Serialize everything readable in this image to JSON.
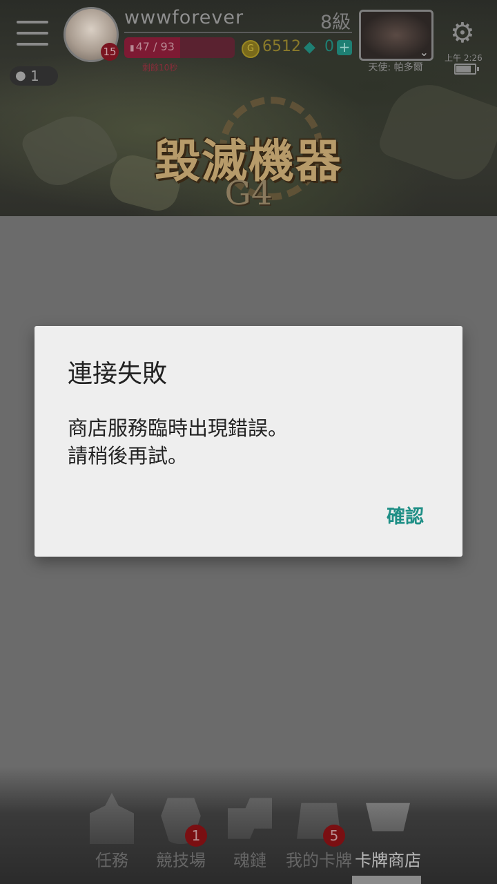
{
  "header": {
    "username": "wwwforever",
    "player_level": "8級",
    "avatar_level": "15",
    "stamina": {
      "current": 47,
      "max": 93,
      "text": "47 / 93"
    },
    "timer": "剩餘10秒",
    "coins": "6512",
    "gems": "0",
    "friends_count": "1",
    "angel_label": "天使: 帕多爾",
    "clock": "上午 2:26",
    "battery_level": 0.8
  },
  "banner": {
    "title": "毀滅機器",
    "subtitle": "G4"
  },
  "dialog": {
    "title": "連接失敗",
    "message_line1": "商店服務臨時出現錯誤。",
    "message_line2": "請稍後再試。",
    "confirm_label": "確認"
  },
  "nav": {
    "items": [
      {
        "label": "任務",
        "badge": ""
      },
      {
        "label": "競技場",
        "badge": "1"
      },
      {
        "label": "魂鏈",
        "badge": ""
      },
      {
        "label": "我的卡牌",
        "badge": "5"
      },
      {
        "label": "卡牌商店",
        "badge": ""
      }
    ],
    "active_index": 4
  },
  "colors": {
    "dialog_accent": "#1f8f86",
    "overlay": "#6b6b6b",
    "badge": "#7a0f12"
  }
}
